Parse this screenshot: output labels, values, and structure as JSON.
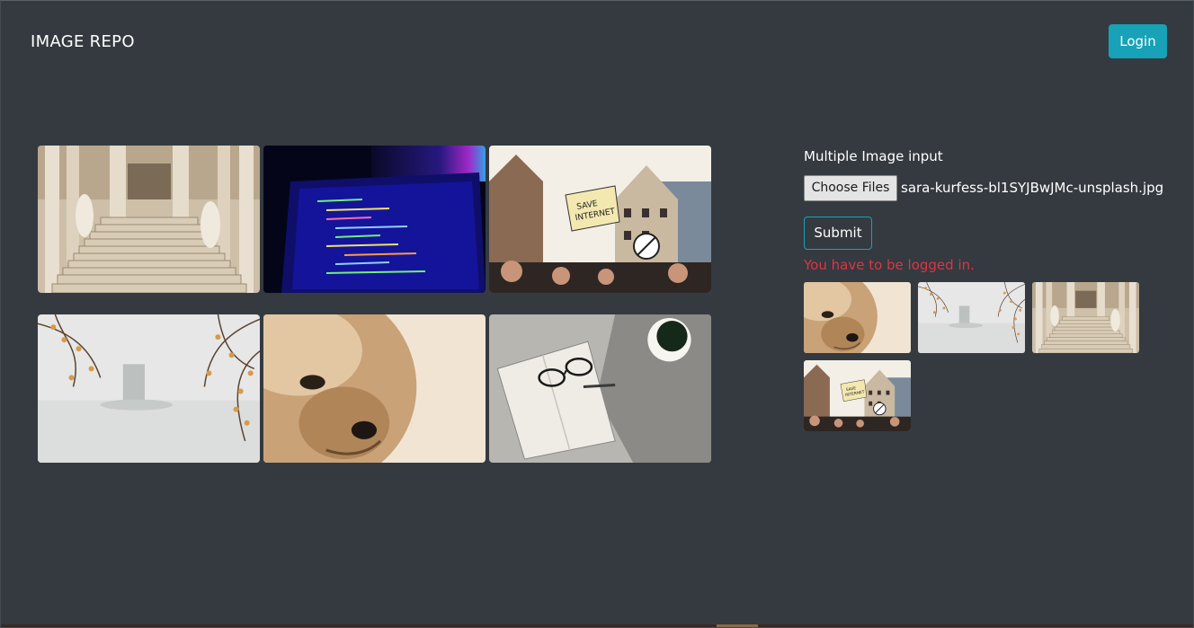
{
  "navbar": {
    "brand": "IMAGE REPO",
    "login_label": "Login"
  },
  "gallery": {
    "images": [
      {
        "subject": "marble staircase with statues"
      },
      {
        "subject": "laptop screen with code"
      },
      {
        "subject": "protest crowd with sign"
      },
      {
        "subject": "misty lake with blossom branches"
      },
      {
        "subject": "close-up of a small dog"
      },
      {
        "subject": "open notebook with glasses and coffee cup"
      }
    ]
  },
  "upload": {
    "label": "Multiple Image input",
    "choose_label": "Choose Files",
    "file_name": "sara-kurfess-bl1SYJBwJMc-unsplash.jpg",
    "submit_label": "Submit",
    "error_message": "You have to be logged in.",
    "error_color": "#dc3545",
    "previews": [
      {
        "subject": "close-up of a small dog"
      },
      {
        "subject": "misty lake with blossom branches"
      },
      {
        "subject": "marble staircase with statues"
      },
      {
        "subject": "protest crowd with sign"
      }
    ]
  },
  "colors": {
    "background": "#343a40",
    "accent": "#17a2b8"
  }
}
